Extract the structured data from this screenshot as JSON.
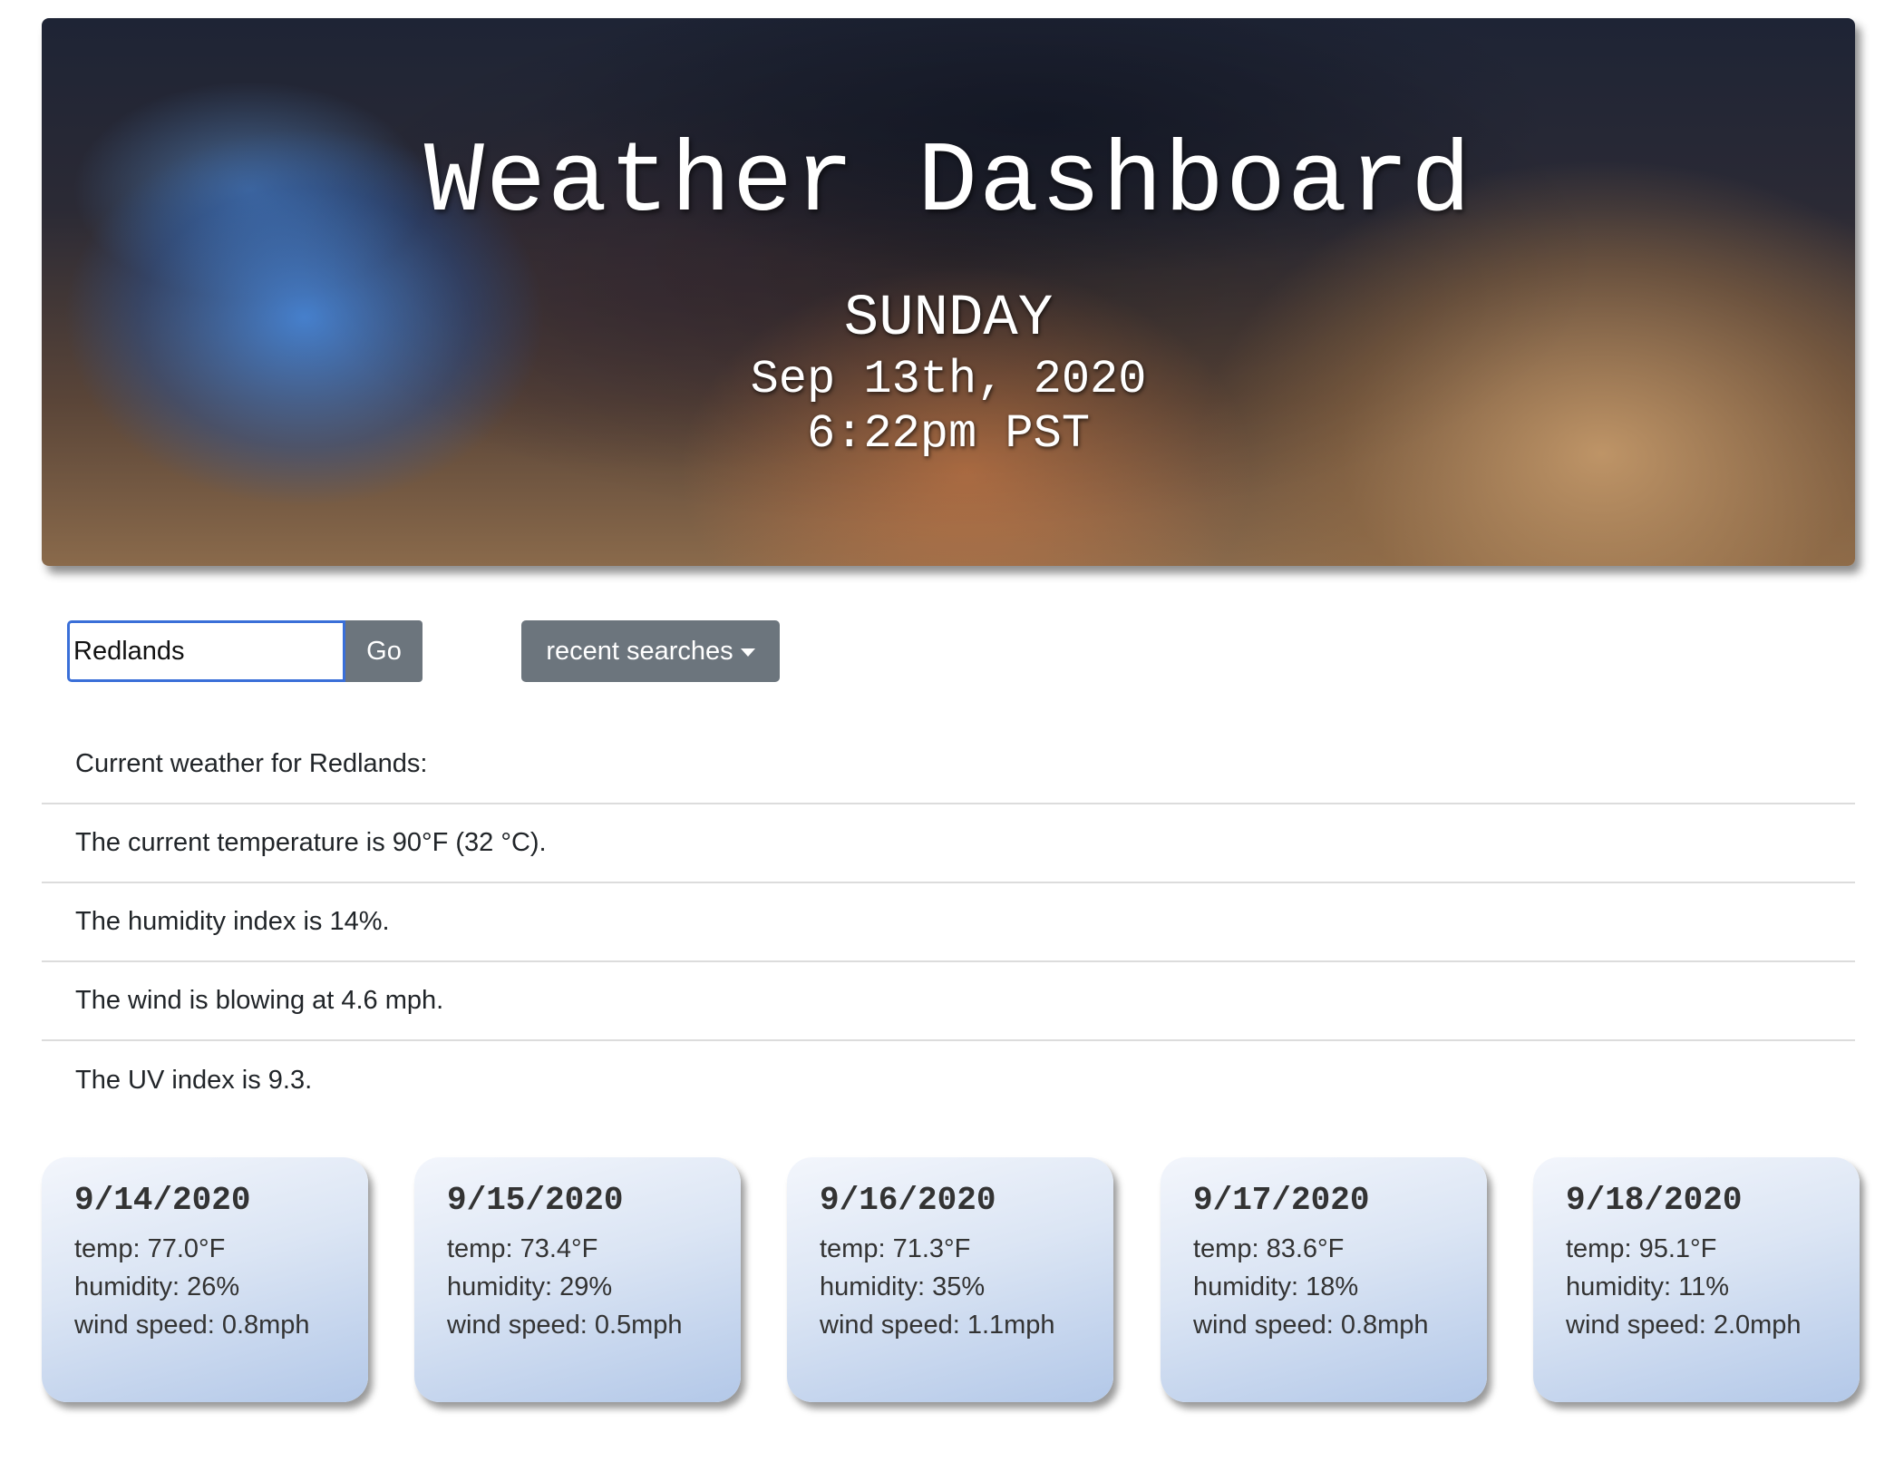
{
  "header": {
    "title": "Weather Dashboard",
    "day": "SUNDAY",
    "date": "Sep 13th, 2020",
    "time": "6:22pm PST"
  },
  "search": {
    "value": "Redlands",
    "go_label": "Go",
    "recent_label": "recent searches"
  },
  "current": {
    "heading": "Current weather for Redlands:",
    "temperature": "The current temperature is 90°F (32 °C).",
    "humidity": "The humidity index is 14%.",
    "wind": "The wind is blowing at 4.6 mph.",
    "uv": "The UV index is 9.3."
  },
  "forecast": [
    {
      "date": "9/14/2020",
      "temp": "temp: 77.0°F",
      "humidity": "humidity: 26%",
      "wind": "wind speed: 0.8mph"
    },
    {
      "date": "9/15/2020",
      "temp": "temp: 73.4°F",
      "humidity": "humidity: 29%",
      "wind": "wind speed: 0.5mph"
    },
    {
      "date": "9/16/2020",
      "temp": "temp: 71.3°F",
      "humidity": "humidity: 35%",
      "wind": "wind speed: 1.1mph"
    },
    {
      "date": "9/17/2020",
      "temp": "temp: 83.6°F",
      "humidity": "humidity: 18%",
      "wind": "wind speed: 0.8mph"
    },
    {
      "date": "9/18/2020",
      "temp": "temp: 95.1°F",
      "humidity": "humidity: 11%",
      "wind": "wind speed: 2.0mph"
    }
  ],
  "colors": {
    "button": "#6c757d",
    "input_focus_border": "#3a6fd8",
    "card_gradient_top": "#f3f6fc",
    "card_gradient_bottom": "#b3c8e8"
  }
}
